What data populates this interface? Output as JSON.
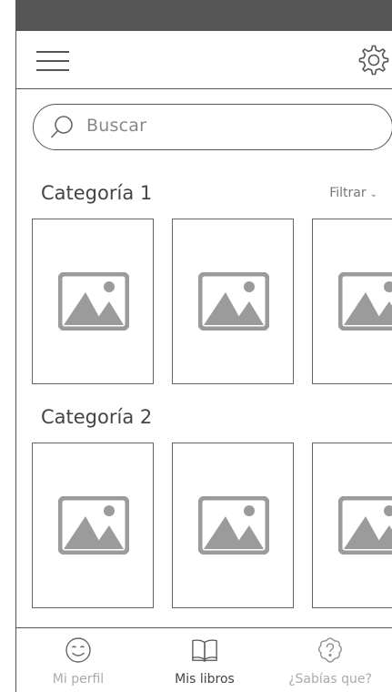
{
  "header": {
    "menu_icon": "hamburger-menu-icon",
    "settings_icon": "gear-icon"
  },
  "search": {
    "placeholder": "Buscar",
    "icon": "search-icon"
  },
  "sections": [
    {
      "title": "Categoría 1",
      "filter_label": "Filtrar",
      "filter_icon": "chevron-down-icon",
      "books": [
        {
          "cover_icon": "image-placeholder-icon"
        },
        {
          "cover_icon": "image-placeholder-icon"
        },
        {
          "cover_icon": "image-placeholder-icon"
        }
      ]
    },
    {
      "title": "Categoría 2",
      "books": [
        {
          "cover_icon": "image-placeholder-icon"
        },
        {
          "cover_icon": "image-placeholder-icon"
        },
        {
          "cover_icon": "image-placeholder-icon"
        }
      ]
    }
  ],
  "tabbar": {
    "active": "Mis libros",
    "tabs": [
      {
        "label": "Mi perfil",
        "icon": "smiley-face-icon"
      },
      {
        "label": "Mis libros",
        "icon": "open-book-icon"
      },
      {
        "label": "¿Sabías que?",
        "icon": "question-badge-icon"
      }
    ]
  },
  "colors": {
    "status_bar": "#555555",
    "outline": "#555555",
    "placeholder_image": "#9b9b9b",
    "inactive_tab_label": "#aaaaaa"
  }
}
